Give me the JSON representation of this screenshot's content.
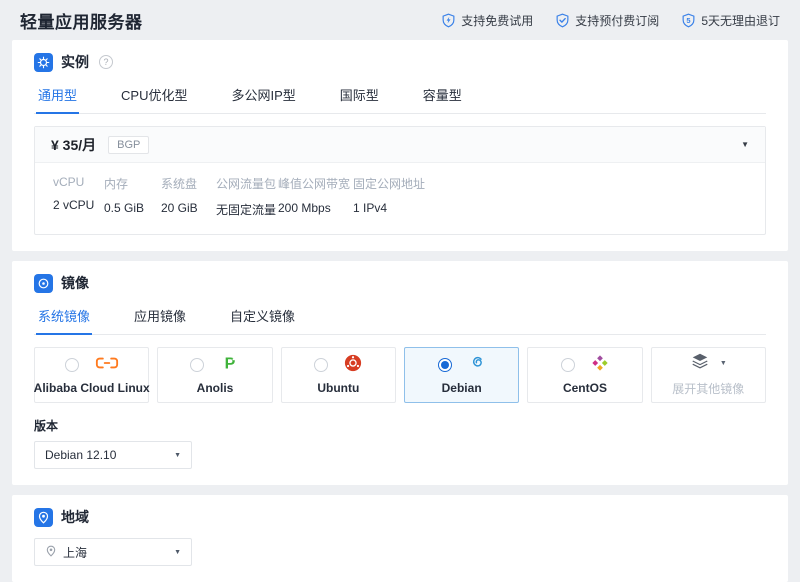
{
  "page_title": "轻量应用服务器",
  "header_badges": [
    {
      "icon": "shield-lightning",
      "label": "支持免费试用"
    },
    {
      "icon": "shield-check",
      "label": "支持预付费订阅"
    },
    {
      "icon": "shield-5",
      "number": "5",
      "label": "5天无理由退订"
    }
  ],
  "colors": {
    "accent_blue": "#2575e6",
    "selected_card_bg": "#f1f8fd",
    "selected_card_border": "#8fc0ea",
    "alibaba_orange": "#ff7a1e",
    "anolis_green": "#3fb33a",
    "ubuntu_red": "#d73d23",
    "debian_blue": "#2d93d6"
  },
  "instance": {
    "title": "实例",
    "tabs": [
      "通用型",
      "CPU优化型",
      "多公网IP型",
      "国际型",
      "容量型"
    ],
    "active_tab": "通用型",
    "plan": {
      "price": "¥ 35/月",
      "line_badge": "BGP",
      "caret": "▼",
      "specs": [
        {
          "label": "vCPU",
          "value": "2 vCPU"
        },
        {
          "label": "内存",
          "value": "0.5 GiB"
        },
        {
          "label": "系统盘",
          "value": "20 GiB"
        },
        {
          "label": "公网流量包",
          "value": "无固定流量"
        },
        {
          "label": "峰值公网带宽",
          "value": "200 Mbps"
        },
        {
          "label": "固定公网地址",
          "value": "1 IPv4"
        }
      ]
    },
    "help_icon": "?"
  },
  "image": {
    "title": "镜像",
    "tabs": [
      "系统镜像",
      "应用镜像",
      "自定义镜像"
    ],
    "active_tab": "系统镜像",
    "os_options": [
      {
        "name": "Alibaba Cloud Linux",
        "selected": false
      },
      {
        "name": "Anolis",
        "selected": false
      },
      {
        "name": "Ubuntu",
        "selected": false
      },
      {
        "name": "Debian",
        "selected": true
      },
      {
        "name": "CentOS",
        "selected": false
      }
    ],
    "expander_label": "展开其他镜像",
    "version_label": "版本",
    "version_value": "Debian 12.10",
    "caret": "▼"
  },
  "region": {
    "title": "地域",
    "value": "上海",
    "caret": "▼"
  }
}
